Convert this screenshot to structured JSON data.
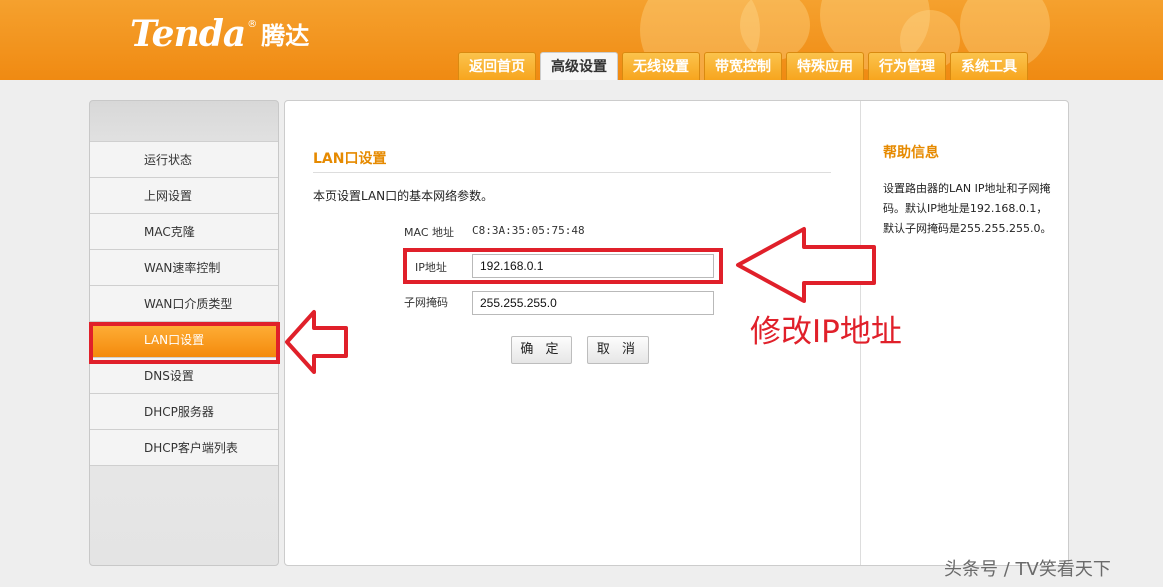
{
  "header": {
    "logo": "Tenda",
    "logo_cn": "腾达",
    "tabs": [
      {
        "label": "返回首页",
        "active": false
      },
      {
        "label": "高级设置",
        "active": true
      },
      {
        "label": "无线设置",
        "active": false
      },
      {
        "label": "带宽控制",
        "active": false
      },
      {
        "label": "特殊应用",
        "active": false
      },
      {
        "label": "行为管理",
        "active": false
      },
      {
        "label": "系统工具",
        "active": false
      }
    ]
  },
  "sidebar": {
    "items": [
      {
        "label": "运行状态",
        "active": false
      },
      {
        "label": "上网设置",
        "active": false
      },
      {
        "label": "MAC克隆",
        "active": false
      },
      {
        "label": "WAN速率控制",
        "active": false
      },
      {
        "label": "WAN口介质类型",
        "active": false
      },
      {
        "label": "LAN口设置",
        "active": true
      },
      {
        "label": "DNS设置",
        "active": false
      },
      {
        "label": "DHCP服务器",
        "active": false
      },
      {
        "label": "DHCP客户端列表",
        "active": false
      }
    ]
  },
  "main": {
    "title": "LAN口设置",
    "description": "本页设置LAN口的基本网络参数。",
    "mac_label": "MAC 地址",
    "mac_value": "C8:3A:35:05:75:48",
    "ip_label": "IP地址",
    "ip_value": "192.168.0.1",
    "mask_label": "子网掩码",
    "mask_value": "255.255.255.0",
    "ok_label": "确 定",
    "cancel_label": "取 消"
  },
  "help": {
    "title": "帮助信息",
    "text": "设置路由器的LAN IP地址和子网掩码。默认IP地址是192.168.0.1，默认子网掩码是255.255.255.0。"
  },
  "annotation": {
    "text": "修改IP地址",
    "color": "#e0202a"
  },
  "watermark": "头条号 / TV笑看天下",
  "colors": {
    "header_orange": "#f39a1e",
    "active_orange": "#f48a0c",
    "title_orange": "#e68a00"
  }
}
